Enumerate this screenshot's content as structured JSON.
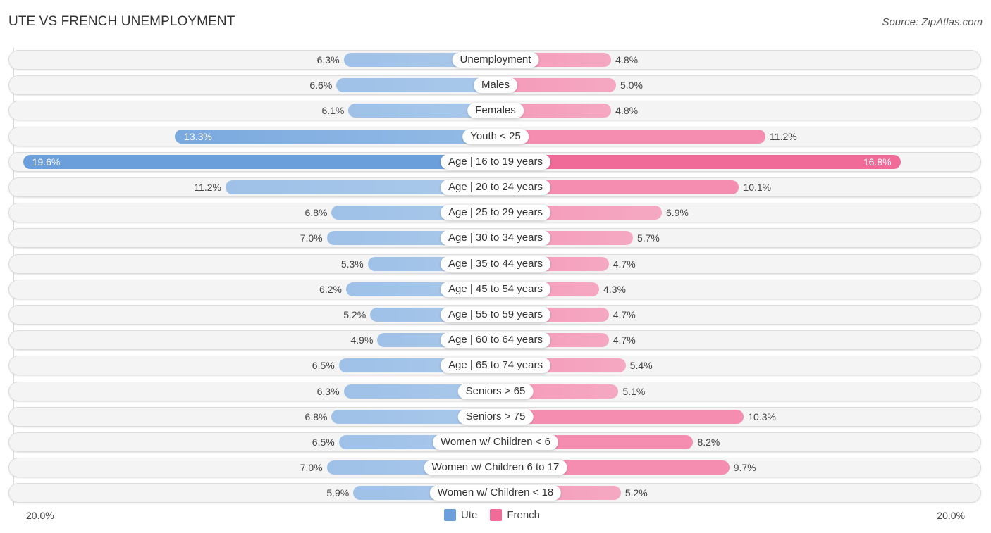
{
  "header": {
    "title": "UTE VS FRENCH UNEMPLOYMENT",
    "source": "Source: ZipAtlas.com"
  },
  "colors": {
    "ute": "#6a9fdc",
    "ute_light": "#a4c5e9",
    "french": "#f06b98",
    "french_light": "#f5a3bf"
  },
  "chart_data": {
    "type": "bar",
    "orientation": "horizontal-diverging",
    "title": "UTE VS FRENCH UNEMPLOYMENT",
    "xlabel": "",
    "ylabel": "",
    "xlim": [
      -20,
      20
    ],
    "axis_labels": {
      "left": "20.0%",
      "right": "20.0%"
    },
    "legend": {
      "position": "bottom-center",
      "entries": [
        "Ute",
        "French"
      ]
    },
    "categories": [
      "Unemployment",
      "Males",
      "Females",
      "Youth < 25",
      "Age | 16 to 19 years",
      "Age | 20 to 24 years",
      "Age | 25 to 29 years",
      "Age | 30 to 34 years",
      "Age | 35 to 44 years",
      "Age | 45 to 54 years",
      "Age | 55 to 59 years",
      "Age | 60 to 64 years",
      "Age | 65 to 74 years",
      "Seniors > 65",
      "Seniors > 75",
      "Women w/ Children < 6",
      "Women w/ Children 6 to 17",
      "Women w/ Children < 18"
    ],
    "series": [
      {
        "name": "Ute",
        "side": "left",
        "values": [
          6.3,
          6.6,
          6.1,
          13.3,
          19.6,
          11.2,
          6.8,
          7.0,
          5.3,
          6.2,
          5.2,
          4.9,
          6.5,
          6.3,
          6.8,
          6.5,
          7.0,
          5.9
        ],
        "labels": [
          "6.3%",
          "6.6%",
          "6.1%",
          "13.3%",
          "19.6%",
          "11.2%",
          "6.8%",
          "7.0%",
          "5.3%",
          "6.2%",
          "5.2%",
          "4.9%",
          "6.5%",
          "6.3%",
          "6.8%",
          "6.5%",
          "7.0%",
          "5.9%"
        ]
      },
      {
        "name": "French",
        "side": "right",
        "values": [
          4.8,
          5.0,
          4.8,
          11.2,
          16.8,
          10.1,
          6.9,
          5.7,
          4.7,
          4.3,
          4.7,
          4.7,
          5.4,
          5.1,
          10.3,
          8.2,
          9.7,
          5.2
        ],
        "labels": [
          "4.8%",
          "5.0%",
          "4.8%",
          "11.2%",
          "16.8%",
          "10.1%",
          "6.9%",
          "5.7%",
          "4.7%",
          "4.3%",
          "4.7%",
          "4.7%",
          "5.4%",
          "5.1%",
          "10.3%",
          "8.2%",
          "9.7%",
          "5.2%"
        ]
      }
    ]
  }
}
